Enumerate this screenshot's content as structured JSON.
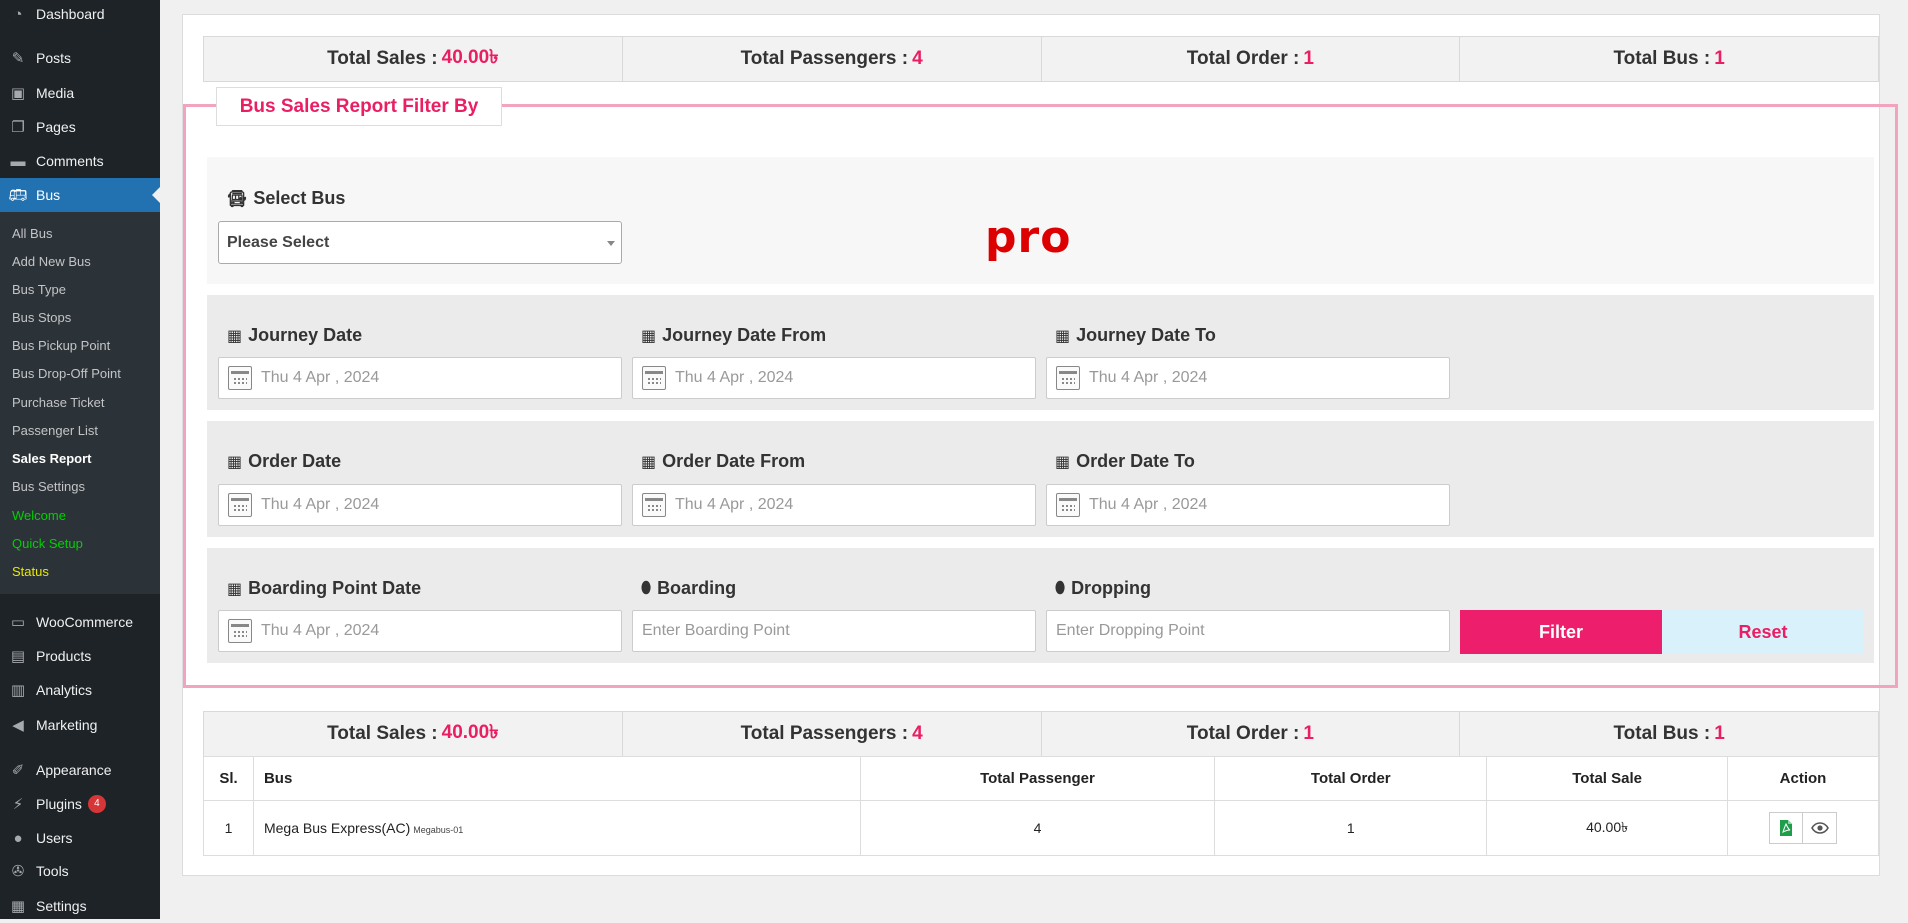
{
  "sidebar": {
    "menu": [
      {
        "label": "Dashboard",
        "icon": "dashboard-icon"
      },
      {
        "label": "Posts",
        "icon": "pin-icon"
      },
      {
        "label": "Media",
        "icon": "media-icon"
      },
      {
        "label": "Pages",
        "icon": "pages-icon"
      },
      {
        "label": "Comments",
        "icon": "comment-icon"
      },
      {
        "label": "Bus",
        "icon": "bus-icon",
        "active": true
      },
      {
        "label": "WooCommerce",
        "icon": "woo-icon"
      },
      {
        "label": "Products",
        "icon": "products-icon"
      },
      {
        "label": "Analytics",
        "icon": "analytics-icon"
      },
      {
        "label": "Marketing",
        "icon": "megaphone-icon"
      },
      {
        "label": "Appearance",
        "icon": "brush-icon"
      },
      {
        "label": "Plugins",
        "icon": "plugin-icon",
        "badge": "4"
      },
      {
        "label": "Users",
        "icon": "user-icon"
      },
      {
        "label": "Tools",
        "icon": "wrench-icon"
      },
      {
        "label": "Settings",
        "icon": "settings-icon"
      }
    ],
    "submenu": [
      {
        "label": "All Bus"
      },
      {
        "label": "Add New Bus"
      },
      {
        "label": "Bus Type"
      },
      {
        "label": "Bus Stops"
      },
      {
        "label": "Bus Pickup Point"
      },
      {
        "label": "Bus Drop-Off Point"
      },
      {
        "label": "Purchase Ticket"
      },
      {
        "label": "Passenger List"
      },
      {
        "label": "Sales Report",
        "current": true
      },
      {
        "label": "Bus Settings"
      },
      {
        "label": "Welcome",
        "color": "#00d000"
      },
      {
        "label": "Quick Setup",
        "color": "#00d000"
      },
      {
        "label": "Status",
        "color": "#e8e800"
      }
    ]
  },
  "summary": {
    "total_sales_label": "Total Sales :",
    "total_sales_value": "40.00৳",
    "total_passengers_label": "Total Passengers :",
    "total_passengers_value": "4",
    "total_order_label": "Total Order :",
    "total_order_value": "1",
    "total_bus_label": "Total Bus :",
    "total_bus_value": "1"
  },
  "filter": {
    "legend": "Bus Sales Report Filter By",
    "select_bus_label": "Select Bus",
    "select_bus_value": "Please Select",
    "pro_text": "pro",
    "journey_date_label": "Journey Date",
    "journey_date_from_label": "Journey Date From",
    "journey_date_to_label": "Journey Date To",
    "order_date_label": "Order Date",
    "order_date_from_label": "Order Date From",
    "order_date_to_label": "Order Date To",
    "boarding_point_date_label": "Boarding Point Date",
    "boarding_label": "Boarding",
    "dropping_label": "Dropping",
    "date_placeholder": "Thu 4 Apr , 2024",
    "boarding_placeholder": "Enter Boarding Point",
    "dropping_placeholder": "Enter Dropping Point",
    "filter_button": "Filter",
    "reset_button": "Reset"
  },
  "table": {
    "headers": [
      "Sl.",
      "Bus",
      "Total Passenger",
      "Total Order",
      "Total Sale",
      "Action"
    ],
    "rows": [
      {
        "sl": "1",
        "bus": "Mega Bus Express(AC)",
        "bus_code": "Megabus-01",
        "passengers": "4",
        "orders": "1",
        "sale": "40.00৳"
      }
    ]
  },
  "colors": {
    "accent": "#e91e63",
    "sidebar_bg": "#1d2327",
    "active_menu": "#2271b1",
    "filter_border": "#f1a3c0",
    "reset_bg": "#d9f1fa"
  }
}
